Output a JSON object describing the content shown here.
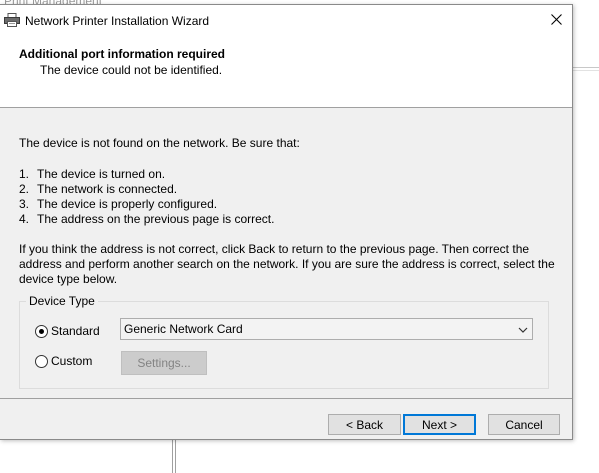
{
  "background_app": {
    "title": "Print Management"
  },
  "window": {
    "title": "Network Printer Installation Wizard",
    "close_icon": "close-icon",
    "app_icon": "printer-icon"
  },
  "header": {
    "title": "Additional port information required",
    "subtitle": "The device could not be identified."
  },
  "body": {
    "intro": "The device is not found on the network.  Be sure that:",
    "checklist": [
      {
        "num": "1.",
        "text": "The device is turned on."
      },
      {
        "num": "2.",
        "text": "The network is connected."
      },
      {
        "num": "3.",
        "text": "The device is properly configured."
      },
      {
        "num": "4.",
        "text": "The address on the previous page is correct."
      }
    ],
    "instructions": [
      "If you think the address is not correct, click Back to return to the previous page.  Then correct the",
      "address and perform another search on the network.  If you are sure the address is correct, select the",
      "device type below."
    ]
  },
  "device_type": {
    "legend": "Device Type",
    "standard_label": "Standard",
    "standard_checked": true,
    "custom_label": "Custom",
    "custom_checked": false,
    "selected_card": "Generic Network Card",
    "settings_label": "Settings..."
  },
  "footer": {
    "back_label": "< Back",
    "next_label": "Next >",
    "cancel_label": "Cancel"
  },
  "colors": {
    "dialog_bg": "#f0f0f0",
    "default_button_border": "#0078d7"
  }
}
